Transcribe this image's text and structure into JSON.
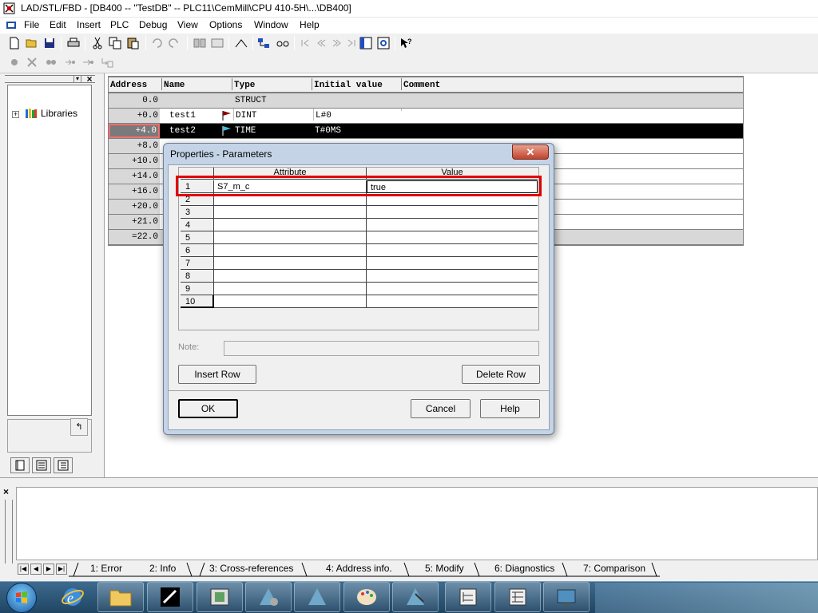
{
  "window": {
    "title": "LAD/STL/FBD  - [DB400 -- \"TestDB\" -- PLC11\\CemMill\\CPU 410-5H\\...\\DB400]"
  },
  "menu": {
    "items": [
      "File",
      "Edit",
      "Insert",
      "PLC",
      "Debug",
      "View",
      "Options",
      "Window",
      "Help"
    ]
  },
  "toolbar": {
    "row1_icons": [
      "new-icon",
      "open-icon",
      "save-icon",
      "print-icon",
      "cut-icon",
      "copy-icon",
      "paste-icon",
      "undo-icon",
      "redo-icon",
      "monitor-icon",
      "zoom-in-icon",
      "zoom-out-icon",
      "previous-icon",
      "next-icon",
      "overview-icon",
      "details-icon",
      "help-icon"
    ],
    "row2_icons": [
      "breakpoint-icon",
      "delete-breakpoint-icon",
      "step-icon",
      "step-into-icon",
      "continue-icon",
      "exit-icon"
    ]
  },
  "libraries": {
    "label": "Libraries"
  },
  "db_table": {
    "headers": [
      "Address",
      "Name",
      "Type",
      "Initial value",
      "Comment"
    ],
    "rows": [
      {
        "address": "0.0",
        "name": "",
        "type": "STRUCT",
        "initial": "",
        "comment": ""
      },
      {
        "address": "+0.0",
        "name": "test1",
        "type": "DINT",
        "initial": "L#0",
        "comment": ""
      },
      {
        "address": "+4.0",
        "name": "test2",
        "type": "TIME",
        "initial": "T#0MS",
        "comment": ""
      },
      {
        "address": "+8.0",
        "name": "",
        "type": "",
        "initial": "",
        "comment": ""
      },
      {
        "address": "+10.0",
        "name": "",
        "type": "",
        "initial": "",
        "comment": ""
      },
      {
        "address": "+14.0",
        "name": "",
        "type": "",
        "initial": "",
        "comment": ""
      },
      {
        "address": "+16.0",
        "name": "",
        "type": "",
        "initial": "",
        "comment": ""
      },
      {
        "address": "+20.0",
        "name": "",
        "type": "",
        "initial": "",
        "comment": ""
      },
      {
        "address": "+21.0",
        "name": "",
        "type": "",
        "initial": "",
        "comment": ""
      },
      {
        "address": "=22.0",
        "name": "",
        "type": "",
        "initial": "",
        "comment": ""
      }
    ]
  },
  "dialog": {
    "title": "Properties - Parameters",
    "col_attribute": "Attribute",
    "col_value": "Value",
    "rows": [
      {
        "num": "1",
        "attribute": "S7_m_c",
        "value": "true"
      },
      {
        "num": "2",
        "attribute": "",
        "value": ""
      },
      {
        "num": "3",
        "attribute": "",
        "value": ""
      },
      {
        "num": "4",
        "attribute": "",
        "value": ""
      },
      {
        "num": "5",
        "attribute": "",
        "value": ""
      },
      {
        "num": "6",
        "attribute": "",
        "value": ""
      },
      {
        "num": "7",
        "attribute": "",
        "value": ""
      },
      {
        "num": "8",
        "attribute": "",
        "value": ""
      },
      {
        "num": "9",
        "attribute": "",
        "value": ""
      },
      {
        "num": "10",
        "attribute": "",
        "value": ""
      }
    ],
    "note_label": "Note:",
    "note_value": "",
    "insert_row": "Insert Row",
    "delete_row": "Delete Row",
    "ok": "OK",
    "cancel": "Cancel",
    "help": "Help"
  },
  "output_tabs": [
    "1: Error",
    "2: Info",
    "3: Cross-references",
    "4: Address info.",
    "5: Modify",
    "6: Diagnostics",
    "7: Comparison"
  ],
  "colors": {
    "highlight_red": "#e00000",
    "selection": "#000000",
    "dialog_frame": "#c4d4e6"
  }
}
